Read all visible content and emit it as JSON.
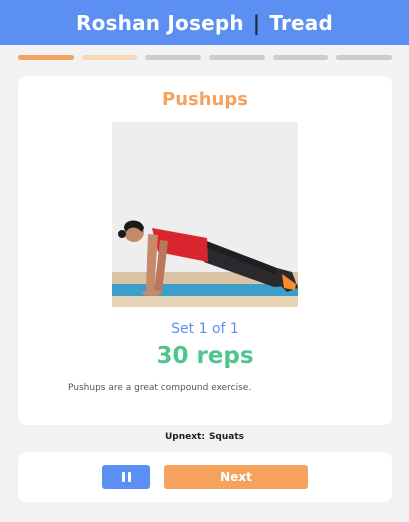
{
  "header": {
    "user_name": "Roshan Joseph",
    "separator": "|",
    "app_name": "Tread",
    "background_color": "#5b8ff2"
  },
  "progress": {
    "segments": [
      {
        "state": "current",
        "color": "#f4a25e"
      },
      {
        "state": "next",
        "color": "#f8d6b8"
      },
      {
        "state": "upcoming",
        "color": "#cccccc"
      },
      {
        "state": "upcoming",
        "color": "#cccccc"
      },
      {
        "state": "upcoming",
        "color": "#cccccc"
      },
      {
        "state": "upcoming",
        "color": "#cccccc"
      }
    ]
  },
  "exercise": {
    "name": "Pushups",
    "image_icon": "pushup-photo",
    "set_text": "Set 1 of 1",
    "reps_text": "30 reps",
    "description": "Pushups are a great compound exercise."
  },
  "upnext": {
    "label": "Upnext:",
    "exercise": "Squats"
  },
  "controls": {
    "pause_icon": "pause-icon",
    "next_label": "Next"
  }
}
